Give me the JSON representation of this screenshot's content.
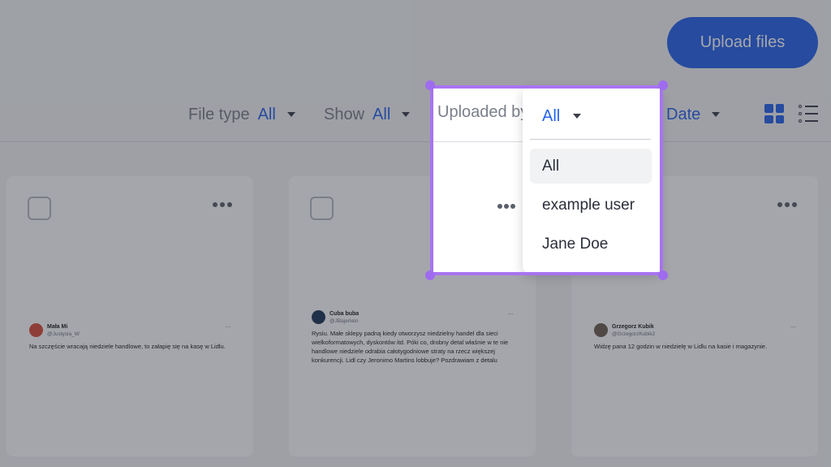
{
  "header": {
    "upload_button_label": "Upload files"
  },
  "filters": {
    "file_type": {
      "label": "File type",
      "value": "All"
    },
    "show": {
      "label": "Show",
      "value": "All"
    },
    "uploaded_by": {
      "label": "Uploaded by",
      "value": "All"
    },
    "sort": {
      "value": "Date"
    }
  },
  "view": {
    "grid_icon": "grid-view-icon",
    "list_icon": "list-view-icon"
  },
  "dropdown": {
    "selected": "All",
    "options": [
      "All",
      "example user",
      "Jane Doe"
    ],
    "active_index": 0
  },
  "cards": [
    {
      "author": "Mała Mi",
      "handle": "@Justysia_W",
      "text": "Na szczęście wracają niedziele handlowe, to załapię się na kasę w Lidlu.",
      "dots": "···"
    },
    {
      "author": "Cuba buba",
      "handle": "@JBajerlein",
      "text": "Rysiu. Małe sklepy padną kiedy otworzysz niedzielny handel dla sieci wielkoformatowych, dyskontów itd. Póki co, drobny detal właśnie w te nie handlowe niedziele odrabia całotygodniowe straty na rzecz większej konkurencji. Lidl czy Jeronimo Martins lobbuje? Pozdrawiam z detalu",
      "dots": "···"
    },
    {
      "author": "Grzegorz Kubik",
      "handle": "@GrzegorzKubik2",
      "text": "Widzę pana 12 godzin w niedzielę w Lidlu na kasie i magazynie.",
      "dots": "···"
    }
  ],
  "colors": {
    "accent": "#2563eb",
    "selection_frame": "#a874f0"
  }
}
